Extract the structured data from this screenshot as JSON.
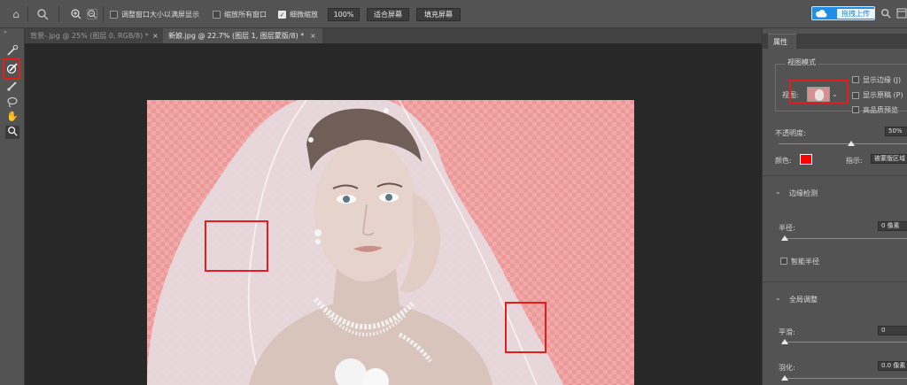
{
  "options_bar": {
    "icons": [
      "home-icon",
      "search-tool-icon",
      "zoom-in-icon",
      "zoom-out-icon"
    ],
    "resize_windows_label": "调整窗口大小以满屏显示",
    "resize_windows_checked": false,
    "zoom_all_label": "缩放所有窗口",
    "zoom_all_checked": false,
    "scrubby_zoom_label": "细微缩放",
    "scrubby_zoom_checked": true,
    "zoom_value": "100%",
    "fit_screen_label": "适合屏幕",
    "fill_screen_label": "填充屏幕",
    "upload_label": "拖拽上传",
    "upload_color": "#1f8ee8"
  },
  "tabs": [
    {
      "label": "背景-.jpg @ 25% (图层 0, RGB/8) *",
      "close": "×",
      "active": false
    },
    {
      "label": "新娘.jpg @ 22.7% (图层 1, 图层蒙版/8) *",
      "close": "×",
      "active": true
    }
  ],
  "tools": [
    "quick-selection-icon",
    "refine-edge-brush-icon",
    "brush-icon",
    "lasso-icon",
    "hand-icon",
    "zoom-icon"
  ],
  "panel": {
    "tab_label": "属性",
    "view_mode": {
      "title": "视图模式",
      "view_label": "视图:",
      "show_edge_label": "显示边缘 (J)",
      "show_original_label": "显示原稿 (P)",
      "hq_preview_label": "高品质预览"
    },
    "opacity": {
      "label": "不透明度:",
      "value": "50%",
      "fraction": 0.5
    },
    "color": {
      "label": "颜色:",
      "swatch": "#ff0000"
    },
    "indicate": {
      "label": "指示:",
      "value": "被蒙版区域"
    },
    "edge_detection": {
      "title": "边缘检测",
      "radius_label": "半径:",
      "radius_value": "0 像素",
      "smart_radius_label": "智能半径"
    },
    "global_refine": {
      "title": "全局调整",
      "smooth_label": "平滑:",
      "smooth_value": "0",
      "feather_label": "羽化:",
      "feather_value": "0.0 像素"
    }
  },
  "colors": {
    "highlight": "#e31c1c",
    "overlay": "#f4a9a9"
  }
}
